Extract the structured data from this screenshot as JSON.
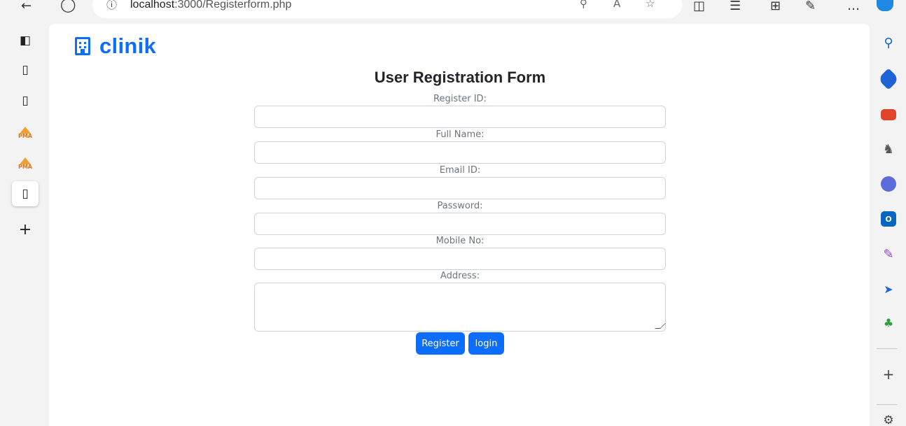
{
  "browser": {
    "url_host": "localhost",
    "url_path": ":3000/Registerform.php"
  },
  "brand": {
    "name": "clinik"
  },
  "form": {
    "title": "User Registration Form",
    "fields": [
      {
        "label": "Register ID:",
        "value": ""
      },
      {
        "label": "Full Name:",
        "value": ""
      },
      {
        "label": "Email ID:",
        "value": ""
      },
      {
        "label": "Password:",
        "value": ""
      },
      {
        "label": "Mobile No:",
        "value": ""
      },
      {
        "label": "Address:",
        "value": ""
      }
    ],
    "register_label": "Register",
    "login_label": "login"
  },
  "colors": {
    "primary": "#0d6efd",
    "pma": "#e8700f"
  }
}
